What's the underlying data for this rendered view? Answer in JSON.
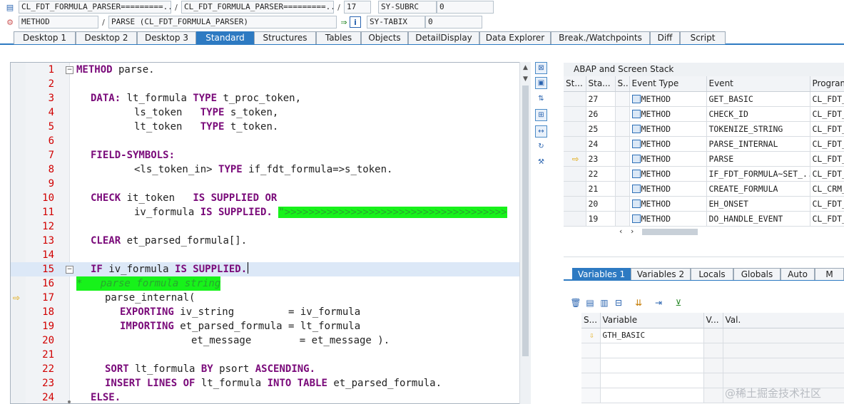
{
  "top": {
    "program1": "CL_FDT_FORMULA_PARSER=========...",
    "program2": "CL_FDT_FORMULA_PARSER=========...",
    "line_no": "17",
    "sysvar1": "SY-SUBRC",
    "sysval1": "0",
    "event_type": "METHOD",
    "event": "PARSE (CL_FDT_FORMULA_PARSER)",
    "sysvar2": "SY-TABIX",
    "sysval2": "0",
    "sep": "/"
  },
  "tabs": [
    "Desktop 1",
    "Desktop 2",
    "Desktop 3",
    "Standard",
    "Structures",
    "Tables",
    "Objects",
    "DetailDisplay",
    "Data Explorer",
    "Break./Watchpoints",
    "Diff",
    "Script"
  ],
  "code_lines": [
    {
      "n": "1"
    },
    {
      "n": "2"
    },
    {
      "n": "3"
    },
    {
      "n": "4"
    },
    {
      "n": "5"
    },
    {
      "n": "6"
    },
    {
      "n": "7"
    },
    {
      "n": "8"
    },
    {
      "n": "9"
    },
    {
      "n": "10"
    },
    {
      "n": "11"
    },
    {
      "n": "12"
    },
    {
      "n": "13"
    },
    {
      "n": "14"
    },
    {
      "n": "15"
    },
    {
      "n": "16"
    },
    {
      "n": "17"
    },
    {
      "n": "18"
    },
    {
      "n": "19"
    },
    {
      "n": "20"
    },
    {
      "n": "21"
    },
    {
      "n": "22"
    },
    {
      "n": "23"
    },
    {
      "n": "24"
    }
  ],
  "code": {
    "l1": [
      "METHOD",
      " parse."
    ],
    "l3": [
      "DATA:",
      " lt_formula ",
      "TYPE",
      " t_proc_token,"
    ],
    "l4": [
      "ls_token   ",
      "TYPE",
      " s_token,"
    ],
    "l5": [
      "lt_token   ",
      "TYPE",
      " t_token."
    ],
    "l7": [
      "FIELD-SYMBOLS:"
    ],
    "l8": [
      "<ls_token_in> ",
      "TYPE",
      " if_fdt_formula=>s_token."
    ],
    "l10": [
      "CHECK",
      " it_token   ",
      "IS SUPPLIED OR"
    ],
    "l11": [
      "iv_formula ",
      "IS SUPPLIED.",
      " ",
      "\">>>>>>>>>>>>>>>>>>>>>>>>>>>>>>>>>>>>>"
    ],
    "l13": [
      "CLEAR",
      " et_parsed_formula[]."
    ],
    "l15": [
      "IF",
      " iv_formula ",
      "IS SUPPLIED."
    ],
    "l16": [
      "*   parse formula string"
    ],
    "l17": [
      "parse_internal("
    ],
    "l18": [
      "EXPORTING",
      " iv_string         = iv_formula"
    ],
    "l19": [
      "IMPORTING",
      " et_parsed_formula = lt_formula"
    ],
    "l20": [
      "et_message        = et_message )."
    ],
    "l22": [
      "SORT",
      " lt_formula ",
      "BY",
      " psort ",
      "ASCENDING."
    ],
    "l23": [
      "INSERT LINES OF",
      " lt_formula ",
      "INTO TABLE",
      " et_parsed_formula."
    ],
    "l24": [
      "ELSE."
    ]
  },
  "stack": {
    "title": "ABAP and Screen Stack",
    "headers": [
      "St...",
      "Sta...",
      "S...",
      "Event Type",
      "Event",
      "Program"
    ],
    "rows": [
      {
        "sta": "27",
        "type": "METHOD",
        "event": "GET_BASIC",
        "prog": "CL_FDT_"
      },
      {
        "sta": "26",
        "type": "METHOD",
        "event": "CHECK_ID",
        "prog": "CL_FDT_"
      },
      {
        "sta": "25",
        "type": "METHOD",
        "event": "TOKENIZE_STRING",
        "prog": "CL_FDT_"
      },
      {
        "sta": "24",
        "type": "METHOD",
        "event": "PARSE_INTERNAL",
        "prog": "CL_FDT_"
      },
      {
        "sta": "23",
        "type": "METHOD",
        "event": "PARSE",
        "prog": "CL_FDT_"
      },
      {
        "sta": "22",
        "type": "METHOD",
        "event": "IF_FDT_FORMULA~SET_...",
        "prog": "CL_FDT_"
      },
      {
        "sta": "21",
        "type": "METHOD",
        "event": "CREATE_FORMULA",
        "prog": "CL_CRM_"
      },
      {
        "sta": "20",
        "type": "METHOD",
        "event": "EH_ONSET",
        "prog": "CL_FDT_"
      },
      {
        "sta": "19",
        "type": "METHOD",
        "event": "DO_HANDLE_EVENT",
        "prog": "CL_FDT_"
      }
    ]
  },
  "var_tabs": [
    "Variables 1",
    "Variables 2",
    "Locals",
    "Globals",
    "Auto",
    "M"
  ],
  "var_table": {
    "headers": [
      "S...",
      "Variable",
      "V...",
      "Val."
    ],
    "rows": [
      {
        "variable": "GTH_BASIC",
        "v": "",
        "val": ""
      }
    ]
  },
  "watermark": "@稀土掘金技术社区"
}
